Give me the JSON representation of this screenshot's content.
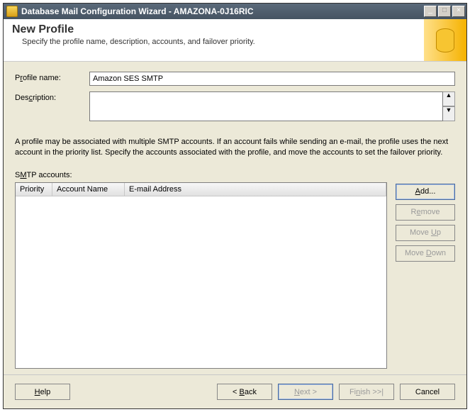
{
  "window": {
    "title": "Database Mail Configuration Wizard - AMAZONA-0J16RIC"
  },
  "header": {
    "title": "New Profile",
    "subtitle": "Specify the profile name, description, accounts, and failover priority."
  },
  "form": {
    "profile_name_label_pre": "P",
    "profile_name_label_u": "r",
    "profile_name_label_post": "ofile name:",
    "profile_name_value": "Amazon SES SMTP",
    "description_label_pre": "Des",
    "description_label_u": "c",
    "description_label_post": "ription:",
    "description_value": ""
  },
  "info_text": "A profile may be associated with multiple SMTP accounts. If an account fails while sending an e-mail, the profile uses the next account in the priority list. Specify the accounts associated with the profile, and move the accounts to set the failover priority.",
  "accounts": {
    "label_pre": "S",
    "label_u": "M",
    "label_post": "TP accounts:",
    "columns": {
      "priority": "Priority",
      "account_name": "Account Name",
      "email": "E-mail Address"
    },
    "rows": []
  },
  "sidebuttons": {
    "add_u": "A",
    "add_post": "dd...",
    "remove_pre": "R",
    "remove_u": "e",
    "remove_post": "move",
    "moveup_pre": "Move ",
    "moveup_u": "U",
    "moveup_post": "p",
    "movedown_pre": "Move ",
    "movedown_u": "D",
    "movedown_post": "own"
  },
  "footer": {
    "help_u": "H",
    "help_post": "elp",
    "back_pre": "< ",
    "back_u": "B",
    "back_post": "ack",
    "next_u": "N",
    "next_post": "ext >",
    "finish_pre": "Fi",
    "finish_u": "n",
    "finish_post": "ish >>|",
    "cancel": "Cancel"
  }
}
